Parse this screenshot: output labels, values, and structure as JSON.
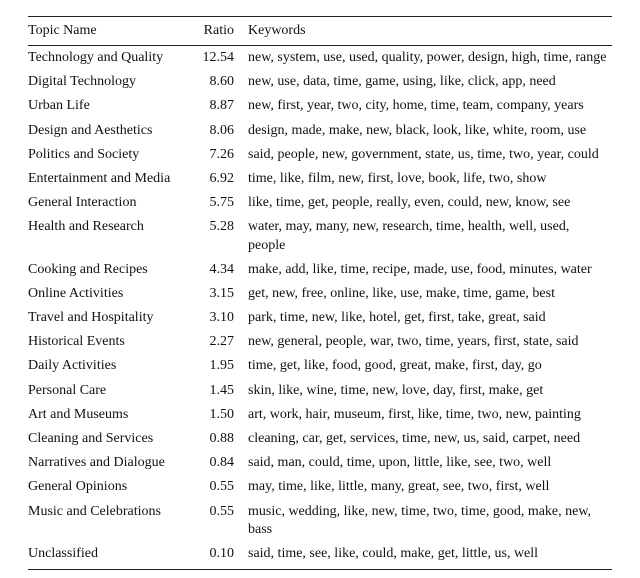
{
  "columns": {
    "topic": "Topic Name",
    "ratio": "Ratio",
    "keywords": "Keywords"
  },
  "rows": [
    {
      "topic": "Technology and Quality",
      "ratio": "12.54",
      "keywords": "new, system, use, used, quality, power, design, high, time, range"
    },
    {
      "topic": "Digital Technology",
      "ratio": "8.60",
      "keywords": "new, use, data, time, game, using, like, click, app, need"
    },
    {
      "topic": "Urban Life",
      "ratio": "8.87",
      "keywords": "new, first, year, two, city, home, time, team, company, years"
    },
    {
      "topic": "Design and Aesthetics",
      "ratio": "8.06",
      "keywords": "design, made, make, new, black, look, like, white, room, use"
    },
    {
      "topic": "Politics and Society",
      "ratio": "7.26",
      "keywords": "said, people, new, government, state, us, time, two, year, could"
    },
    {
      "topic": "Entertainment and Media",
      "ratio": "6.92",
      "keywords": "time, like, film, new, first, love, book, life, two, show"
    },
    {
      "topic": "General Interaction",
      "ratio": "5.75",
      "keywords": "like, time, get, people, really, even, could, new, know, see"
    },
    {
      "topic": "Health and Research",
      "ratio": "5.28",
      "keywords": "water, may, many, new, research, time, health, well, used, people"
    },
    {
      "topic": "Cooking and Recipes",
      "ratio": "4.34",
      "keywords": "make, add, like, time, recipe, made, use, food, minutes, water"
    },
    {
      "topic": "Online Activities",
      "ratio": "3.15",
      "keywords": "get, new, free, online, like, use, make, time, game, best"
    },
    {
      "topic": "Travel and Hospitality",
      "ratio": "3.10",
      "keywords": "park, time, new, like, hotel, get, first, take, great, said"
    },
    {
      "topic": "Historical Events",
      "ratio": "2.27",
      "keywords": "new, general, people, war, two, time, years, first, state, said"
    },
    {
      "topic": "Daily Activities",
      "ratio": "1.95",
      "keywords": "time, get, like, food, good, great, make, first, day, go"
    },
    {
      "topic": "Personal Care",
      "ratio": "1.45",
      "keywords": "skin, like, wine, time, new, love, day, first, make, get"
    },
    {
      "topic": "Art and Museums",
      "ratio": "1.50",
      "keywords": "art, work, hair, museum, first, like, time, two, new, painting"
    },
    {
      "topic": "Cleaning and Services",
      "ratio": "0.88",
      "keywords": "cleaning, car, get, services, time, new, us, said, carpet, need"
    },
    {
      "topic": "Narratives and Dialogue",
      "ratio": "0.84",
      "keywords": "said, man, could, time, upon, little, like, see, two, well"
    },
    {
      "topic": "General Opinions",
      "ratio": "0.55",
      "keywords": "may, time, like, little, many, great, see, two, first, well"
    },
    {
      "topic": "Music and Celebrations",
      "ratio": "0.55",
      "keywords": "music, wedding, like, new, time, two, time, good, make, new, bass"
    },
    {
      "topic": "Unclassified",
      "ratio": "0.10",
      "keywords": "said, time, see, like, could, make, get, little, us, well"
    }
  ]
}
